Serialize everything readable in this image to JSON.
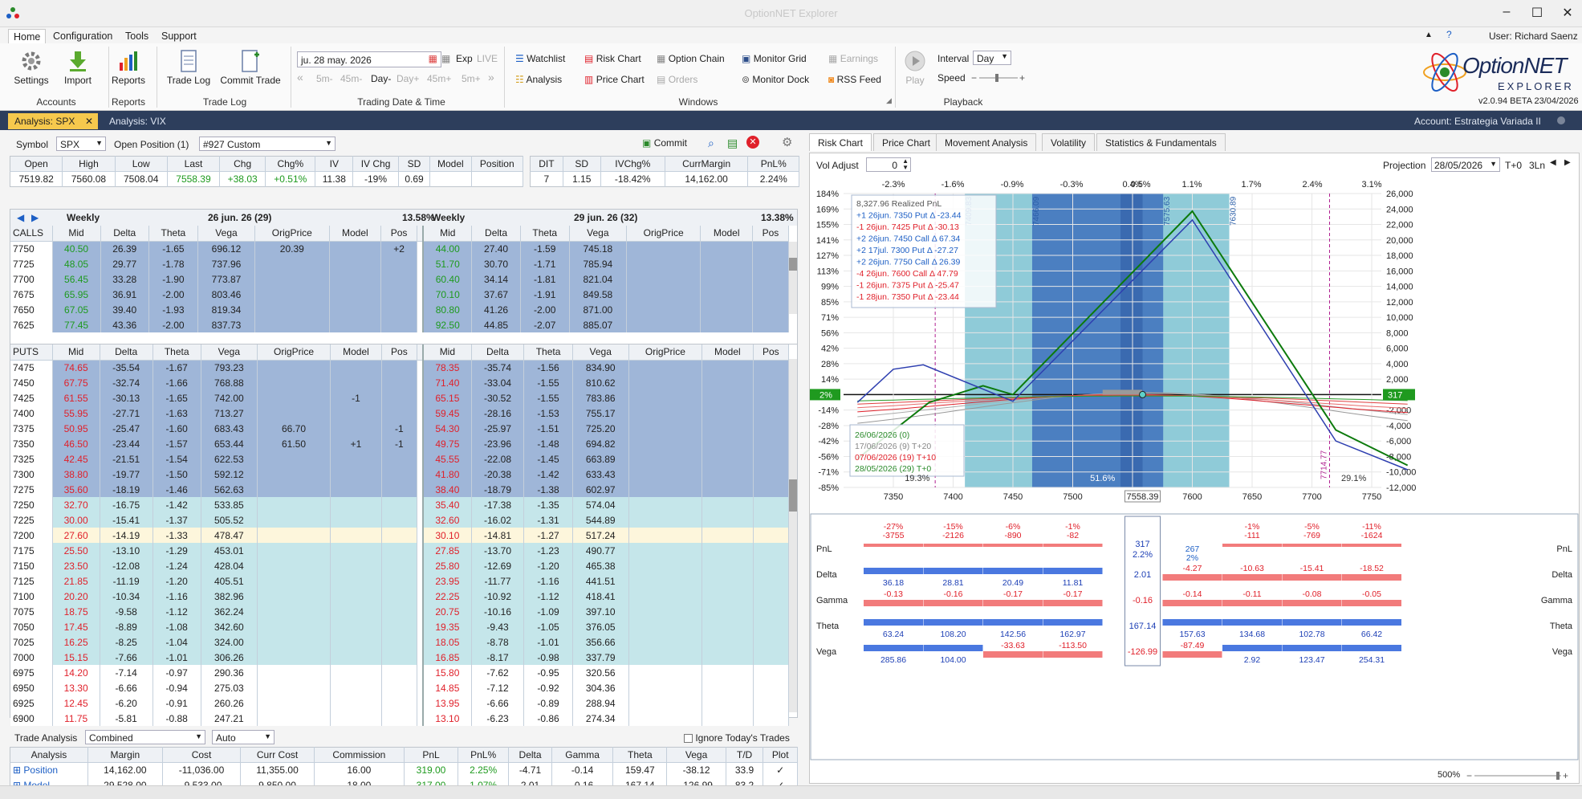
{
  "app": {
    "title": "OptionNET Explorer",
    "user": "User: Richard Saenz",
    "version": "v2.0.94 BETA 23/04/2026",
    "logo_text": "OptionNET",
    "logo_sub": "EXPLORER"
  },
  "menu": [
    "Home",
    "Configuration",
    "Tools",
    "Support"
  ],
  "ribbon": {
    "accounts": {
      "buttons": [
        "Settings",
        "Import"
      ],
      "label": "Accounts"
    },
    "reports": {
      "buttons": [
        "Reports"
      ],
      "label": "Reports"
    },
    "tradelog": {
      "buttons": [
        "Trade Log",
        "Commit Trade"
      ],
      "label": "Trade Log"
    },
    "trading": {
      "date": "ju. 28 may. 2026",
      "exp": "Exp",
      "live": "LIVE",
      "steps": [
        "5m-",
        "45m-",
        "Day-",
        "Day+",
        "45m+",
        "5m+"
      ],
      "label": "Trading Date & Time"
    },
    "windows": {
      "items": [
        "Watchlist",
        "Risk Chart",
        "Option Chain",
        "Monitor Grid",
        "Earnings",
        "Analysis",
        "Price Chart",
        "Orders",
        "Monitor Dock",
        "RSS Feed"
      ],
      "label": "Windows"
    },
    "playback": {
      "play": "Play",
      "interval_label": "Interval",
      "interval": "Day",
      "speed_label": "Speed",
      "label": "Playback"
    }
  },
  "doc_tabs": [
    "Analysis: SPX",
    "Analysis: VIX"
  ],
  "account": "Account: Estrategia Variada II",
  "symbol_bar": {
    "symbol_label": "Symbol",
    "symbol": "SPX",
    "open_position_label": "Open Position (1)",
    "position": "#927 Custom",
    "commit": "Commit"
  },
  "quote": {
    "headers": [
      "Open",
      "High",
      "Low",
      "Last",
      "Chg",
      "Chg%",
      "IV",
      "IV Chg",
      "SD",
      "Model",
      "Position"
    ],
    "values": [
      "7519.82",
      "7560.08",
      "7508.04",
      "7558.39",
      "+38.03",
      "+0.51%",
      "11.38",
      "-19%",
      "0.69",
      "",
      ""
    ]
  },
  "position_stats": {
    "headers": [
      "DIT",
      "SD",
      "IVChg%",
      "CurrMargin",
      "PnL%"
    ],
    "values": [
      "7",
      "1.15",
      "-18.42%",
      "14,162.00",
      "2.24%"
    ]
  },
  "exp_left": {
    "name": "Weekly",
    "date": "26 jun. 26 (29)",
    "iv": "13.58%"
  },
  "exp_right": {
    "name": "Weekly",
    "date": "29 jun. 26 (32)",
    "iv": "13.38%"
  },
  "chain_headers": [
    "Mid",
    "Delta",
    "Theta",
    "Vega",
    "OrigPrice",
    "Model",
    "Pos"
  ],
  "calls_label": "CALLS",
  "puts_label": "PUTS",
  "calls": [
    {
      "strike": "7750",
      "l": [
        "40.50",
        "26.39",
        "-1.65",
        "696.12",
        "20.39",
        "",
        "+2"
      ],
      "r": [
        "44.00",
        "27.40",
        "-1.59",
        "745.18",
        "",
        "",
        ""
      ],
      "s": "dark"
    },
    {
      "strike": "7725",
      "l": [
        "48.05",
        "29.77",
        "-1.78",
        "737.96",
        "",
        "",
        ""
      ],
      "r": [
        "51.70",
        "30.70",
        "-1.71",
        "785.94",
        "",
        "",
        ""
      ],
      "s": "dark"
    },
    {
      "strike": "7700",
      "l": [
        "56.45",
        "33.28",
        "-1.90",
        "773.87",
        "",
        "",
        ""
      ],
      "r": [
        "60.40",
        "34.14",
        "-1.81",
        "821.04",
        "",
        "",
        ""
      ],
      "s": "dark"
    },
    {
      "strike": "7675",
      "l": [
        "65.95",
        "36.91",
        "-2.00",
        "803.46",
        "",
        "",
        ""
      ],
      "r": [
        "70.10",
        "37.67",
        "-1.91",
        "849.58",
        "",
        "",
        ""
      ],
      "s": "dark"
    },
    {
      "strike": "7650",
      "l": [
        "67.05",
        "39.40",
        "-1.93",
        "819.34",
        "",
        "",
        ""
      ],
      "r": [
        "80.80",
        "41.26",
        "-2.00",
        "871.00",
        "",
        "",
        ""
      ],
      "s": "dark"
    },
    {
      "strike": "7625",
      "l": [
        "77.45",
        "43.36",
        "-2.00",
        "837.73",
        "",
        "",
        ""
      ],
      "r": [
        "92.50",
        "44.85",
        "-2.07",
        "885.07",
        "",
        "",
        ""
      ],
      "s": "dark"
    }
  ],
  "puts": [
    {
      "strike": "7475",
      "l": [
        "74.65",
        "-35.54",
        "-1.67",
        "793.23",
        "",
        "",
        ""
      ],
      "r": [
        "78.35",
        "-35.74",
        "-1.56",
        "834.90",
        "",
        "",
        ""
      ],
      "s": "dark"
    },
    {
      "strike": "7450",
      "l": [
        "67.75",
        "-32.74",
        "-1.66",
        "768.88",
        "",
        "",
        ""
      ],
      "r": [
        "71.40",
        "-33.04",
        "-1.55",
        "810.62",
        "",
        "",
        ""
      ],
      "s": "dark"
    },
    {
      "strike": "7425",
      "l": [
        "61.55",
        "-30.13",
        "-1.65",
        "742.00",
        "",
        "-1",
        ""
      ],
      "r": [
        "65.15",
        "-30.52",
        "-1.55",
        "783.86",
        "",
        "",
        ""
      ],
      "s": "dark"
    },
    {
      "strike": "7400",
      "l": [
        "55.95",
        "-27.71",
        "-1.63",
        "713.27",
        "",
        "",
        ""
      ],
      "r": [
        "59.45",
        "-28.16",
        "-1.53",
        "755.17",
        "",
        "",
        ""
      ],
      "s": "dark"
    },
    {
      "strike": "7375",
      "l": [
        "50.95",
        "-25.47",
        "-1.60",
        "683.43",
        "66.70",
        "",
        "-1"
      ],
      "r": [
        "54.30",
        "-25.97",
        "-1.51",
        "725.20",
        "",
        "",
        ""
      ],
      "s": "dark"
    },
    {
      "strike": "7350",
      "l": [
        "46.50",
        "-23.44",
        "-1.57",
        "653.44",
        "61.50",
        "+1",
        "-1"
      ],
      "r": [
        "49.75",
        "-23.96",
        "-1.48",
        "694.82",
        "",
        "",
        ""
      ],
      "s": "dark"
    },
    {
      "strike": "7325",
      "l": [
        "42.45",
        "-21.51",
        "-1.54",
        "622.53",
        "",
        "",
        ""
      ],
      "r": [
        "45.55",
        "-22.08",
        "-1.45",
        "663.89",
        "",
        "",
        ""
      ],
      "s": "dark"
    },
    {
      "strike": "7300",
      "l": [
        "38.80",
        "-19.77",
        "-1.50",
        "592.12",
        "",
        "",
        ""
      ],
      "r": [
        "41.80",
        "-20.38",
        "-1.42",
        "633.43",
        "",
        "",
        ""
      ],
      "s": "dark"
    },
    {
      "strike": "7275",
      "l": [
        "35.60",
        "-18.19",
        "-1.46",
        "562.63",
        "",
        "",
        ""
      ],
      "r": [
        "38.40",
        "-18.79",
        "-1.38",
        "602.97",
        "",
        "",
        ""
      ],
      "s": "dark"
    },
    {
      "strike": "7250",
      "l": [
        "32.70",
        "-16.75",
        "-1.42",
        "533.85",
        "",
        "",
        ""
      ],
      "r": [
        "35.40",
        "-17.38",
        "-1.35",
        "574.04",
        "",
        "",
        ""
      ],
      "s": "light"
    },
    {
      "strike": "7225",
      "l": [
        "30.00",
        "-15.41",
        "-1.37",
        "505.52",
        "",
        "",
        ""
      ],
      "r": [
        "32.60",
        "-16.02",
        "-1.31",
        "544.89",
        "",
        "",
        ""
      ],
      "s": "light"
    },
    {
      "strike": "7200",
      "l": [
        "27.60",
        "-14.19",
        "-1.33",
        "478.47",
        "",
        "",
        ""
      ],
      "r": [
        "30.10",
        "-14.81",
        "-1.27",
        "517.24",
        "",
        "",
        ""
      ],
      "s": "atm"
    },
    {
      "strike": "7175",
      "l": [
        "25.50",
        "-13.10",
        "-1.29",
        "453.01",
        "",
        "",
        ""
      ],
      "r": [
        "27.85",
        "-13.70",
        "-1.23",
        "490.77",
        "",
        "",
        ""
      ],
      "s": "light"
    },
    {
      "strike": "7150",
      "l": [
        "23.50",
        "-12.08",
        "-1.24",
        "428.04",
        "",
        "",
        ""
      ],
      "r": [
        "25.80",
        "-12.69",
        "-1.20",
        "465.38",
        "",
        "",
        ""
      ],
      "s": "light"
    },
    {
      "strike": "7125",
      "l": [
        "21.85",
        "-11.19",
        "-1.20",
        "405.51",
        "",
        "",
        ""
      ],
      "r": [
        "23.95",
        "-11.77",
        "-1.16",
        "441.51",
        "",
        "",
        ""
      ],
      "s": "light"
    },
    {
      "strike": "7100",
      "l": [
        "20.20",
        "-10.34",
        "-1.16",
        "382.96",
        "",
        "",
        ""
      ],
      "r": [
        "22.25",
        "-10.92",
        "-1.12",
        "418.41",
        "",
        "",
        ""
      ],
      "s": "light"
    },
    {
      "strike": "7075",
      "l": [
        "18.75",
        "-9.58",
        "-1.12",
        "362.24",
        "",
        "",
        ""
      ],
      "r": [
        "20.75",
        "-10.16",
        "-1.09",
        "397.10",
        "",
        "",
        ""
      ],
      "s": "light"
    },
    {
      "strike": "7050",
      "l": [
        "17.45",
        "-8.89",
        "-1.08",
        "342.60",
        "",
        "",
        ""
      ],
      "r": [
        "19.35",
        "-9.43",
        "-1.05",
        "376.05",
        "",
        "",
        ""
      ],
      "s": "light"
    },
    {
      "strike": "7025",
      "l": [
        "16.25",
        "-8.25",
        "-1.04",
        "324.00",
        "",
        "",
        ""
      ],
      "r": [
        "18.05",
        "-8.78",
        "-1.01",
        "356.66",
        "",
        "",
        ""
      ],
      "s": "light"
    },
    {
      "strike": "7000",
      "l": [
        "15.15",
        "-7.66",
        "-1.01",
        "306.26",
        "",
        "",
        ""
      ],
      "r": [
        "16.85",
        "-8.17",
        "-0.98",
        "337.79",
        "",
        "",
        ""
      ],
      "s": "light"
    },
    {
      "strike": "6975",
      "l": [
        "14.20",
        "-7.14",
        "-0.97",
        "290.36",
        "",
        "",
        ""
      ],
      "r": [
        "15.80",
        "-7.62",
        "-0.95",
        "320.56",
        "",
        "",
        ""
      ],
      "s": "plain"
    },
    {
      "strike": "6950",
      "l": [
        "13.30",
        "-6.66",
        "-0.94",
        "275.03",
        "",
        "",
        ""
      ],
      "r": [
        "14.85",
        "-7.12",
        "-0.92",
        "304.36",
        "",
        "",
        ""
      ],
      "s": "plain"
    },
    {
      "strike": "6925",
      "l": [
        "12.45",
        "-6.20",
        "-0.91",
        "260.26",
        "",
        "",
        ""
      ],
      "r": [
        "13.95",
        "-6.66",
        "-0.89",
        "288.94",
        "",
        "",
        ""
      ],
      "s": "plain"
    },
    {
      "strike": "6900",
      "l": [
        "11.75",
        "-5.81",
        "-0.88",
        "247.21",
        "",
        "",
        ""
      ],
      "r": [
        "13.10",
        "-6.23",
        "-0.86",
        "274.34",
        "",
        "",
        ""
      ],
      "s": "plain"
    }
  ],
  "trade_analysis": {
    "label": "Trade Analysis",
    "mode": "Combined",
    "auto": "Auto",
    "ignore": "Ignore Today's Trades",
    "headers": [
      "Analysis",
      "Margin",
      "Cost",
      "Curr Cost",
      "Commission",
      "PnL",
      "PnL%",
      "Delta",
      "Gamma",
      "Theta",
      "Vega",
      "T/D",
      "Plot"
    ],
    "rows": [
      [
        "Position",
        "14,162.00",
        "-11,036.00",
        "11,355.00",
        "16.00",
        "319.00",
        "2.25%",
        "-4.71",
        "-0.14",
        "159.47",
        "-38.12",
        "33.9",
        "✓"
      ],
      [
        "Model",
        "29,528.00",
        "-9,533.00",
        "9,850.00",
        "18.00",
        "317.00",
        "1.07%",
        "2.01",
        "-0.16",
        "167.14",
        "-126.99",
        "83.2",
        "✓"
      ]
    ]
  },
  "right_tabs": [
    "Risk Chart",
    "Price Chart",
    "Movement Analysis",
    "Volatility",
    "Statistics & Fundamentals"
  ],
  "risk": {
    "vol_adjust_label": "Vol Adjust",
    "vol_adjust": "0",
    "projection_label": "Projection",
    "projection_date": "28/05/2026",
    "projection_mode": "T+0",
    "projection_ln": "3Ln",
    "top_pct": [
      "-2.3%",
      "-1.6%",
      "-0.9%",
      "-0.3%",
      "0.4%",
      "0.5%",
      "1.1%",
      "1.7%",
      "2.4%",
      "3.1%"
    ],
    "left_axis": [
      "184%",
      "169%",
      "155%",
      "141%",
      "127%",
      "113%",
      "99%",
      "85%",
      "71%",
      "56%",
      "42%",
      "28%",
      "14%",
      "2%",
      "-14%",
      "-28%",
      "-42%",
      "-56%",
      "-71%",
      "-85%"
    ],
    "right_axis": [
      "26,000",
      "24,000",
      "22,000",
      "20,000",
      "18,000",
      "16,000",
      "14,000",
      "12,000",
      "10,000",
      "8,000",
      "6,000",
      "4,000",
      "2,000",
      "317",
      "-2,000",
      "-4,000",
      "-6,000",
      "-8,000",
      "-10,000",
      "-12,000"
    ],
    "x_axis": [
      "7350",
      "7400",
      "7450",
      "7500",
      "7558.39",
      "7600",
      "7650",
      "7700",
      "7750"
    ],
    "strike_labels": [
      "7409.83",
      "7466.09",
      "7575.63",
      "7630.89"
    ],
    "legend": [
      {
        "t": "8,327.96 Realized PnL",
        "c": "#555"
      },
      {
        "t": "+1 26jun. 7350 Put Δ -23.44",
        "c": "#1d5fc5"
      },
      {
        "t": "-1 26jun. 7425 Put Δ -30.13",
        "c": "#e0202a"
      },
      {
        "t": "+2 26jun. 7450 Call Δ 67.34",
        "c": "#1d5fc5"
      },
      {
        "t": "+2 17jul. 7300 Put Δ -27.27",
        "c": "#1d5fc5"
      },
      {
        "t": "+2 26jun. 7750 Call Δ 26.39",
        "c": "#1d5fc5"
      },
      {
        "t": "-4 26jun. 7600 Call Δ 47.79",
        "c": "#e0202a"
      },
      {
        "t": "-1 26jun. 7375 Put Δ -25.47",
        "c": "#e0202a"
      },
      {
        "t": "-1 28jun. 7350 Put Δ -23.44",
        "c": "#e0202a"
      }
    ],
    "date_legend": [
      {
        "t": "26/06/2026 (0)",
        "c": "#2a8a2a"
      },
      {
        "t": "17/06/2026 (9) T+20",
        "c": "#888"
      },
      {
        "t": "07/06/2026 (19) T+10",
        "c": "#e0202a"
      },
      {
        "t": "28/05/2026 (29) T+0",
        "c": "#2a8a2a"
      }
    ],
    "bottom_pct": [
      "19.3%",
      "51.6%",
      "29.1%"
    ],
    "vline_label": "7714.77",
    "zero_badge_left": "2%",
    "zero_badge_right": "317"
  },
  "greeks": {
    "rows": [
      "PnL",
      "Delta",
      "Gamma",
      "Theta",
      "Vega"
    ],
    "pnl_pct": [
      "-27%",
      "-15%",
      "-6%",
      "-1%",
      "",
      "",
      "-1%",
      "-5%",
      "-11%"
    ],
    "pnl_val": [
      "-3755",
      "-2126",
      "-890",
      "-82",
      "",
      "",
      "-111",
      "-769",
      "-1624"
    ],
    "delta": [
      "36.18",
      "28.81",
      "20.49",
      "11.81",
      "",
      "-4.27",
      "-10.63",
      "-15.41",
      "-18.52"
    ],
    "gamma": [
      "-0.13",
      "-0.16",
      "-0.17",
      "-0.17",
      "",
      "-0.14",
      "-0.11",
      "-0.08",
      "-0.05"
    ],
    "theta": [
      "63.24",
      "108.20",
      "142.56",
      "162.97",
      "",
      "157.63",
      "134.68",
      "102.78",
      "66.42"
    ],
    "vega": [
      "285.86",
      "104.00",
      "-33.63",
      "-113.50",
      "",
      "-87.49",
      "2.92",
      "123.47",
      "254.31"
    ],
    "center": {
      "pnl": "317",
      "pnl_pct": "2.2%",
      "delta": "2.01",
      "gamma": "-0.16",
      "theta": "167.14",
      "vega": "-126.99"
    },
    "extra_pnl": "267",
    "extra_pnl_pct": "2%"
  },
  "zoom": "500%"
}
